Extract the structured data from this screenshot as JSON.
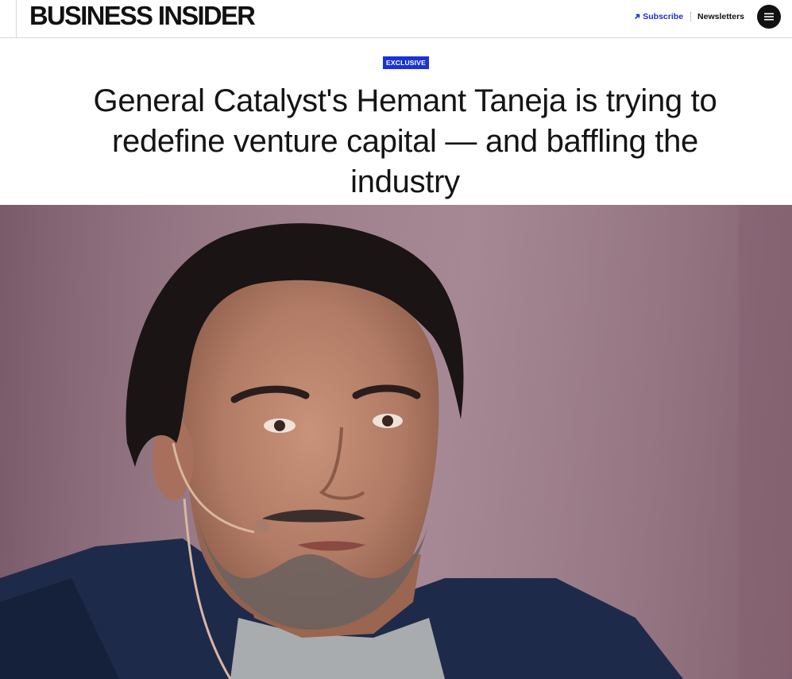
{
  "header": {
    "logo_text": "BUSINESS INSIDER",
    "subscribe_label": "Subscribe",
    "newsletters_label": "Newsletters",
    "menu_icon": "hamburger-menu-icon",
    "subscribe_icon": "arrow-up-right-icon",
    "subscribe_color": "#1c2ed0"
  },
  "article": {
    "badge": "EXCLUSIVE",
    "badge_color": "#1a32d6",
    "headline_lines": [
      "General Catalyst's Hemant Taneja is trying to",
      "redefine venture capital — and baffling the",
      "industry"
    ]
  }
}
